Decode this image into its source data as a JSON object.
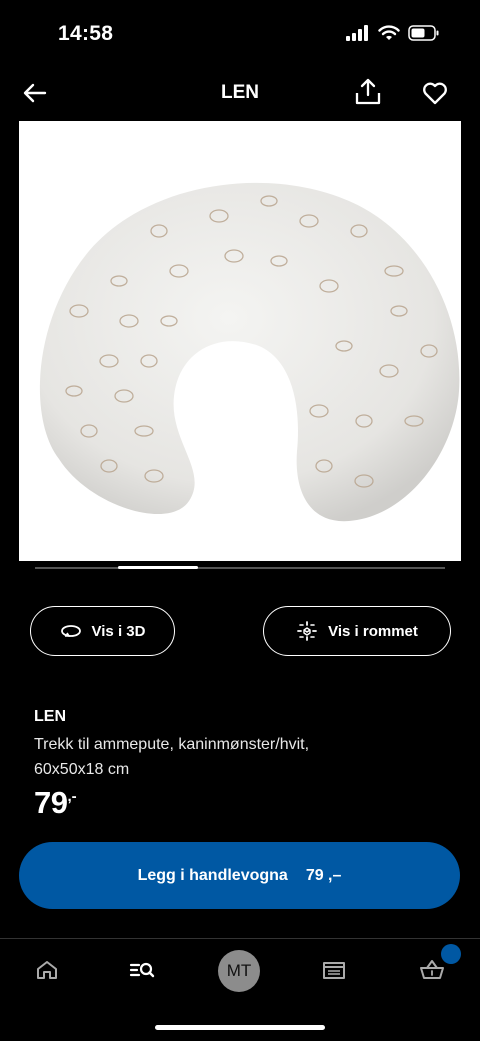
{
  "status_bar": {
    "time": "14:58"
  },
  "header": {
    "title": "LEN"
  },
  "actions": {
    "view_3d": "Vis i 3D",
    "view_room": "Vis i rommet"
  },
  "product": {
    "name": "LEN",
    "description_line1": "Trekk til ammepute, kaninmønster/hvit,",
    "description_line2": "60x50x18 cm",
    "price": "79",
    "price_suffix": ",-"
  },
  "cart_button": {
    "label": "Legg i handlevogna",
    "price": "79 ,–"
  },
  "gallery": {
    "active_index": 1
  },
  "tabbar": {
    "avatar_initials": "MT"
  },
  "colors": {
    "accent": "#0058a3",
    "background": "#000000"
  }
}
